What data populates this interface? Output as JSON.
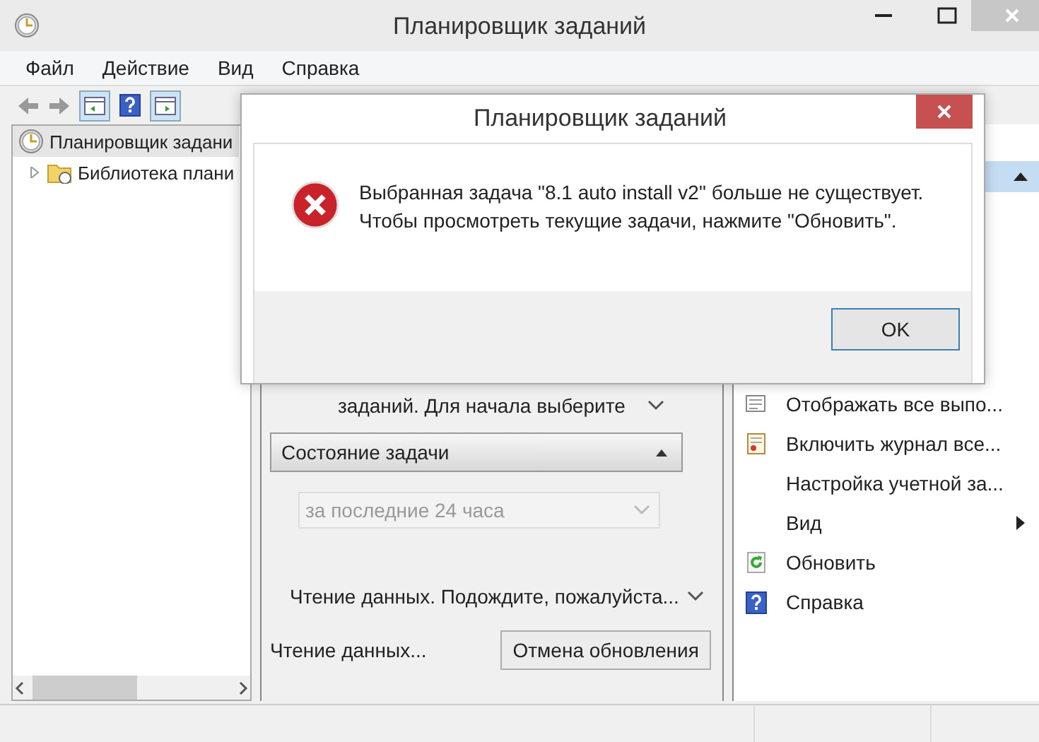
{
  "window": {
    "title": "Планировщик заданий"
  },
  "menu": [
    "Файл",
    "Действие",
    "Вид",
    "Справка"
  ],
  "tree": [
    {
      "label": "Планировщик задани",
      "selected": true,
      "children": [
        {
          "label": "Библиотека плани",
          "selected": false,
          "expanded": false
        }
      ]
    }
  ],
  "middle": {
    "description_line": "заданий. Для начала выберите",
    "section": {
      "title": "Состояние задачи",
      "expanded": true
    },
    "period": {
      "value": "за последние 24 часа",
      "disabled": true
    },
    "loading_message": "Чтение данных. Подождите, пожалуйста...",
    "status": "Чтение данных...",
    "cancel_button": "Отмена обновления"
  },
  "actions": {
    "header": {
      "expanded": true
    },
    "items": [
      {
        "kind": "display",
        "label": "Отображать все выпо..."
      },
      {
        "kind": "journal",
        "label": "Включить журнал все..."
      },
      {
        "kind": "plain",
        "label": "Настройка учетной за..."
      },
      {
        "kind": "submenu",
        "label": "Вид"
      },
      {
        "kind": "refresh",
        "label": "Обновить"
      },
      {
        "kind": "help",
        "label": "Справка"
      }
    ]
  },
  "dialog": {
    "title": "Планировщик заданий",
    "message": [
      "Выбранная задача \"8.1 auto install v2\" больше не существует.",
      "Чтобы просмотреть текущие задачи, нажмите \"Обновить\"."
    ],
    "button": "OK"
  }
}
